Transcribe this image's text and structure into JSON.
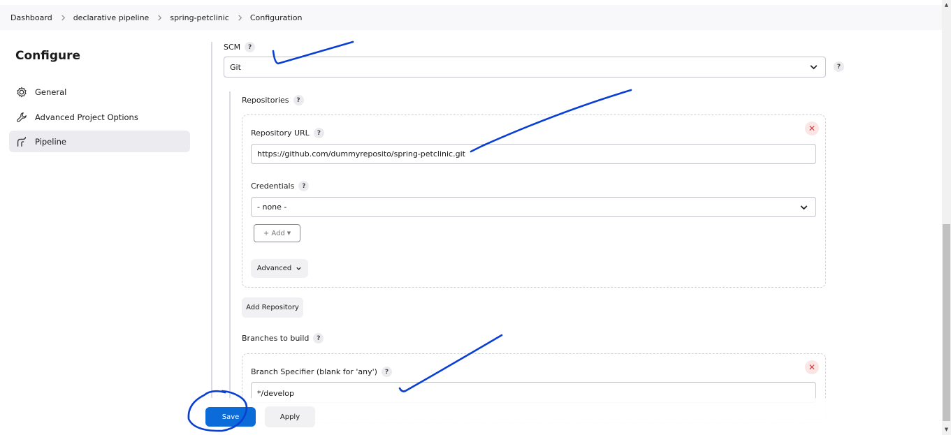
{
  "breadcrumb": [
    "Dashboard",
    "declarative pipeline",
    "spring-petclinic",
    "Configuration"
  ],
  "sidebar": {
    "title": "Configure",
    "items": [
      {
        "label": "General",
        "icon": "gear-icon"
      },
      {
        "label": "Advanced Project Options",
        "icon": "wrench-icon"
      },
      {
        "label": "Pipeline",
        "icon": "pipeline-icon",
        "active": true
      }
    ]
  },
  "scm": {
    "label": "SCM",
    "value": "Git"
  },
  "repositories": {
    "label": "Repositories",
    "url_label": "Repository URL",
    "url_value": "https://github.com/dummyreposito/spring-petclinic.git",
    "credentials_label": "Credentials",
    "credentials_value": "- none -",
    "add_label": "+ Add",
    "advanced_label": "Advanced",
    "add_repository_label": "Add Repository"
  },
  "branches": {
    "label": "Branches to build",
    "specifier_label": "Branch Specifier (blank for 'any')",
    "specifier_value": "*/develop"
  },
  "help_glyph": "?",
  "remove_glyph": "✕",
  "actions": {
    "save_label": "Save",
    "apply_label": "Apply"
  },
  "colors": {
    "primary": "#0b6bd8",
    "annotation": "#0a3fd4",
    "danger": "#d23b3b"
  }
}
